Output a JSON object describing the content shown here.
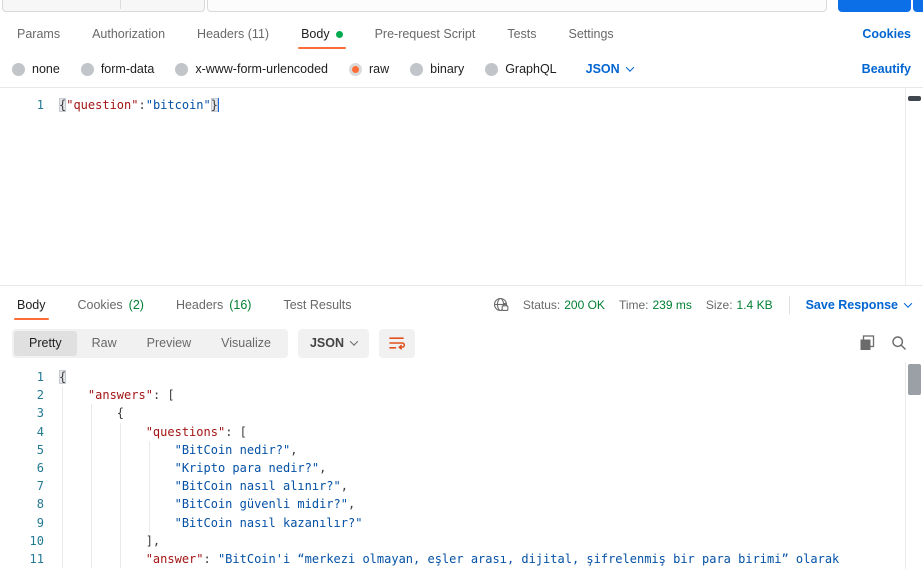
{
  "colors": {
    "accent_orange": "#FF6C37",
    "link_blue": "#0265D2",
    "send_button_blue": "#0D6FE8",
    "success_green": "#007F31",
    "unsaved_dot_green": "#03AA4F",
    "code_key_color": "#A31515",
    "code_string_color": "#0451A5",
    "line_number_color": "#237893"
  },
  "request": {
    "tabs": [
      {
        "label": "Params"
      },
      {
        "label": "Authorization"
      },
      {
        "label": "Headers (11)"
      },
      {
        "label": "Body",
        "active": true,
        "changed_dot": true
      },
      {
        "label": "Pre-request Script"
      },
      {
        "label": "Tests"
      },
      {
        "label": "Settings"
      }
    ],
    "cookies_link": "Cookies",
    "body_types": [
      {
        "label": "none"
      },
      {
        "label": "form-data"
      },
      {
        "label": "x-www-form-urlencoded"
      },
      {
        "label": "raw",
        "selected": true
      },
      {
        "label": "binary"
      },
      {
        "label": "GraphQL"
      }
    ],
    "raw_format": "JSON",
    "beautify_link": "Beautify",
    "editor": {
      "lines": [
        {
          "n": "1",
          "indent": 0,
          "segs": [
            {
              "t": "{",
              "c": "p",
              "hl": true
            },
            {
              "t": "\"question\"",
              "c": "k"
            },
            {
              "t": ":",
              "c": "p"
            },
            {
              "t": "\"bitcoin\"",
              "c": "s"
            },
            {
              "t": "}",
              "c": "p",
              "hl": true,
              "cursor": true
            }
          ]
        }
      ]
    }
  },
  "response": {
    "tabs": [
      {
        "label": "Body",
        "active": true
      },
      {
        "label": "Cookies",
        "count": "(2)"
      },
      {
        "label": "Headers",
        "count": "(16)"
      },
      {
        "label": "Test Results"
      }
    ],
    "meta": {
      "status_label": "Status:",
      "status_value": "200 OK",
      "time_label": "Time:",
      "time_value": "239 ms",
      "size_label": "Size:",
      "size_value": "1.4 KB"
    },
    "save_response_label": "Save Response",
    "view_tabs": [
      {
        "label": "Pretty",
        "active": true
      },
      {
        "label": "Raw"
      },
      {
        "label": "Preview"
      },
      {
        "label": "Visualize"
      }
    ],
    "format_select": "JSON",
    "editor": {
      "lines": [
        {
          "n": "1",
          "indent": 0,
          "segs": [
            {
              "t": "{",
              "c": "p",
              "hl": true
            }
          ]
        },
        {
          "n": "2",
          "indent": 4,
          "segs": [
            {
              "t": "\"answers\"",
              "c": "k"
            },
            {
              "t": ": [",
              "c": "p"
            }
          ]
        },
        {
          "n": "3",
          "indent": 8,
          "segs": [
            {
              "t": "{",
              "c": "p"
            }
          ]
        },
        {
          "n": "4",
          "indent": 12,
          "segs": [
            {
              "t": "\"questions\"",
              "c": "k"
            },
            {
              "t": ": [",
              "c": "p"
            }
          ]
        },
        {
          "n": "5",
          "indent": 16,
          "segs": [
            {
              "t": "\"BitCoin nedir?\"",
              "c": "s"
            },
            {
              "t": ",",
              "c": "p"
            }
          ]
        },
        {
          "n": "6",
          "indent": 16,
          "segs": [
            {
              "t": "\"Kripto para nedir?\"",
              "c": "s"
            },
            {
              "t": ",",
              "c": "p"
            }
          ]
        },
        {
          "n": "7",
          "indent": 16,
          "segs": [
            {
              "t": "\"BitCoin nasıl alınır?\"",
              "c": "s"
            },
            {
              "t": ",",
              "c": "p"
            }
          ]
        },
        {
          "n": "8",
          "indent": 16,
          "segs": [
            {
              "t": "\"BitCoin güvenli midir?\"",
              "c": "s"
            },
            {
              "t": ",",
              "c": "p"
            }
          ]
        },
        {
          "n": "9",
          "indent": 16,
          "segs": [
            {
              "t": "\"BitCoin nasıl kazanılır?\"",
              "c": "s"
            }
          ]
        },
        {
          "n": "10",
          "indent": 12,
          "segs": [
            {
              "t": "],",
              "c": "p"
            }
          ]
        },
        {
          "n": "11",
          "indent": 12,
          "segs": [
            {
              "t": "\"answer\"",
              "c": "k"
            },
            {
              "t": ": ",
              "c": "p"
            },
            {
              "t": "\"BitCoin'i “merkezi olmayan, eşler arası, dijital, şifrelenmiş bir para birimi” olarak",
              "c": "s"
            }
          ]
        }
      ]
    }
  }
}
